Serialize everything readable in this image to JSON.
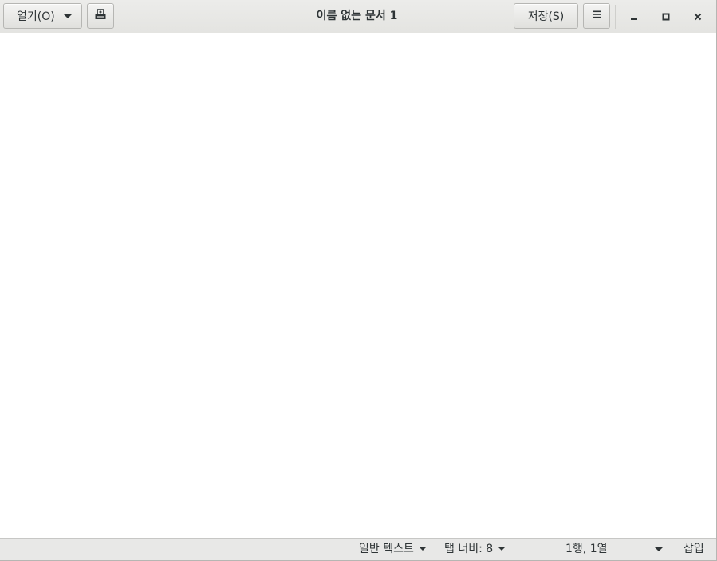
{
  "header": {
    "open_label": "열기(O)",
    "title": "이름 없는 문서 1",
    "save_label": "저장(S)",
    "icons": {
      "new_document": "new-document-icon",
      "menu": "hamburger-menu-icon",
      "minimize": "minimize-icon",
      "maximize": "maximize-icon",
      "close": "close-icon"
    }
  },
  "editor": {
    "content": ""
  },
  "statusbar": {
    "language": "일반 텍스트",
    "tab_width": "탭 너비: 8",
    "cursor_position": "1행, 1열",
    "insert_mode": "삽입"
  }
}
